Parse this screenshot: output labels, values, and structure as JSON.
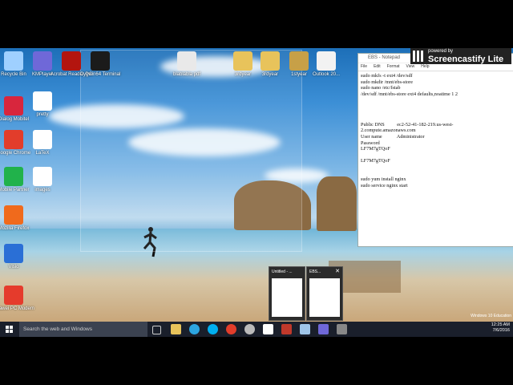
{
  "desktop_icons": [
    {
      "label": "Recycle Bin",
      "color": "#9fd0ff"
    },
    {
      "label": "KMPlayer",
      "color": "#6f68d8"
    },
    {
      "label": "Acrobat Reader DC",
      "color": "#b3150f"
    },
    {
      "label": "Cygwin64 Terminal",
      "color": "#1b1b1b"
    },
    {
      "label": "blablabla pdf",
      "color": "#e9e9e9"
    },
    {
      "label": "3rdyear",
      "color": "#e8c35b"
    },
    {
      "label": "3rdyear",
      "color": "#e8c35b"
    },
    {
      "label": "1styear",
      "color": "#c7a047"
    },
    {
      "label": "Outlook 20...",
      "color": "#f2f2f2"
    },
    {
      "label": "Dialog Mobitel",
      "color": "#d8263d"
    },
    {
      "label": "pretty",
      "color": "#ffffff"
    },
    {
      "label": "Google Chrome",
      "color": "#e23d2b"
    },
    {
      "label": "LaTeX",
      "color": "#ffffff"
    },
    {
      "label": "Mobile Partner",
      "color": "#21b24b"
    },
    {
      "label": "images",
      "color": "#ffffff"
    },
    {
      "label": "Mozilla Firefox",
      "color": "#f06a1c"
    },
    {
      "label": "Visio",
      "color": "#2a6fd6"
    },
    {
      "label": "Huawei PC Modem",
      "color": "#e53b2c"
    }
  ],
  "notepad": {
    "title": "EBS - Notepad",
    "menu": [
      "File",
      "Edit",
      "Format",
      "View",
      "Help"
    ],
    "content": "sudo mkfs -t ext4 /dev/sdf\nsudo mkdir /mnt/ebs-store\nsudo nano /etc/fstab\n/dev/sdf /mnt/ebs-store ext4 defaults,noatime 1 2\n\n\n\n\nPublic DNS          ec2-52-41-182-219.us-west-\n2.compute.amazonaws.com\nUser name            Administrator\nPassword\nLF7M7gTQoF\n\nLF7M7gTQoF\n\n\nsudo yum install nginx\nsudo service nginx start"
  },
  "screencastify": {
    "small": "powered by",
    "big": "Screencastify Lite"
  },
  "thumbnails": [
    {
      "title": "Untitled - ..."
    },
    {
      "title": "EBS..."
    }
  ],
  "taskbar": {
    "search_placeholder": "Search the web and Windows",
    "time": "12:25 AM",
    "date": "7/6/2016"
  },
  "watermark": "Windows 10 Education"
}
